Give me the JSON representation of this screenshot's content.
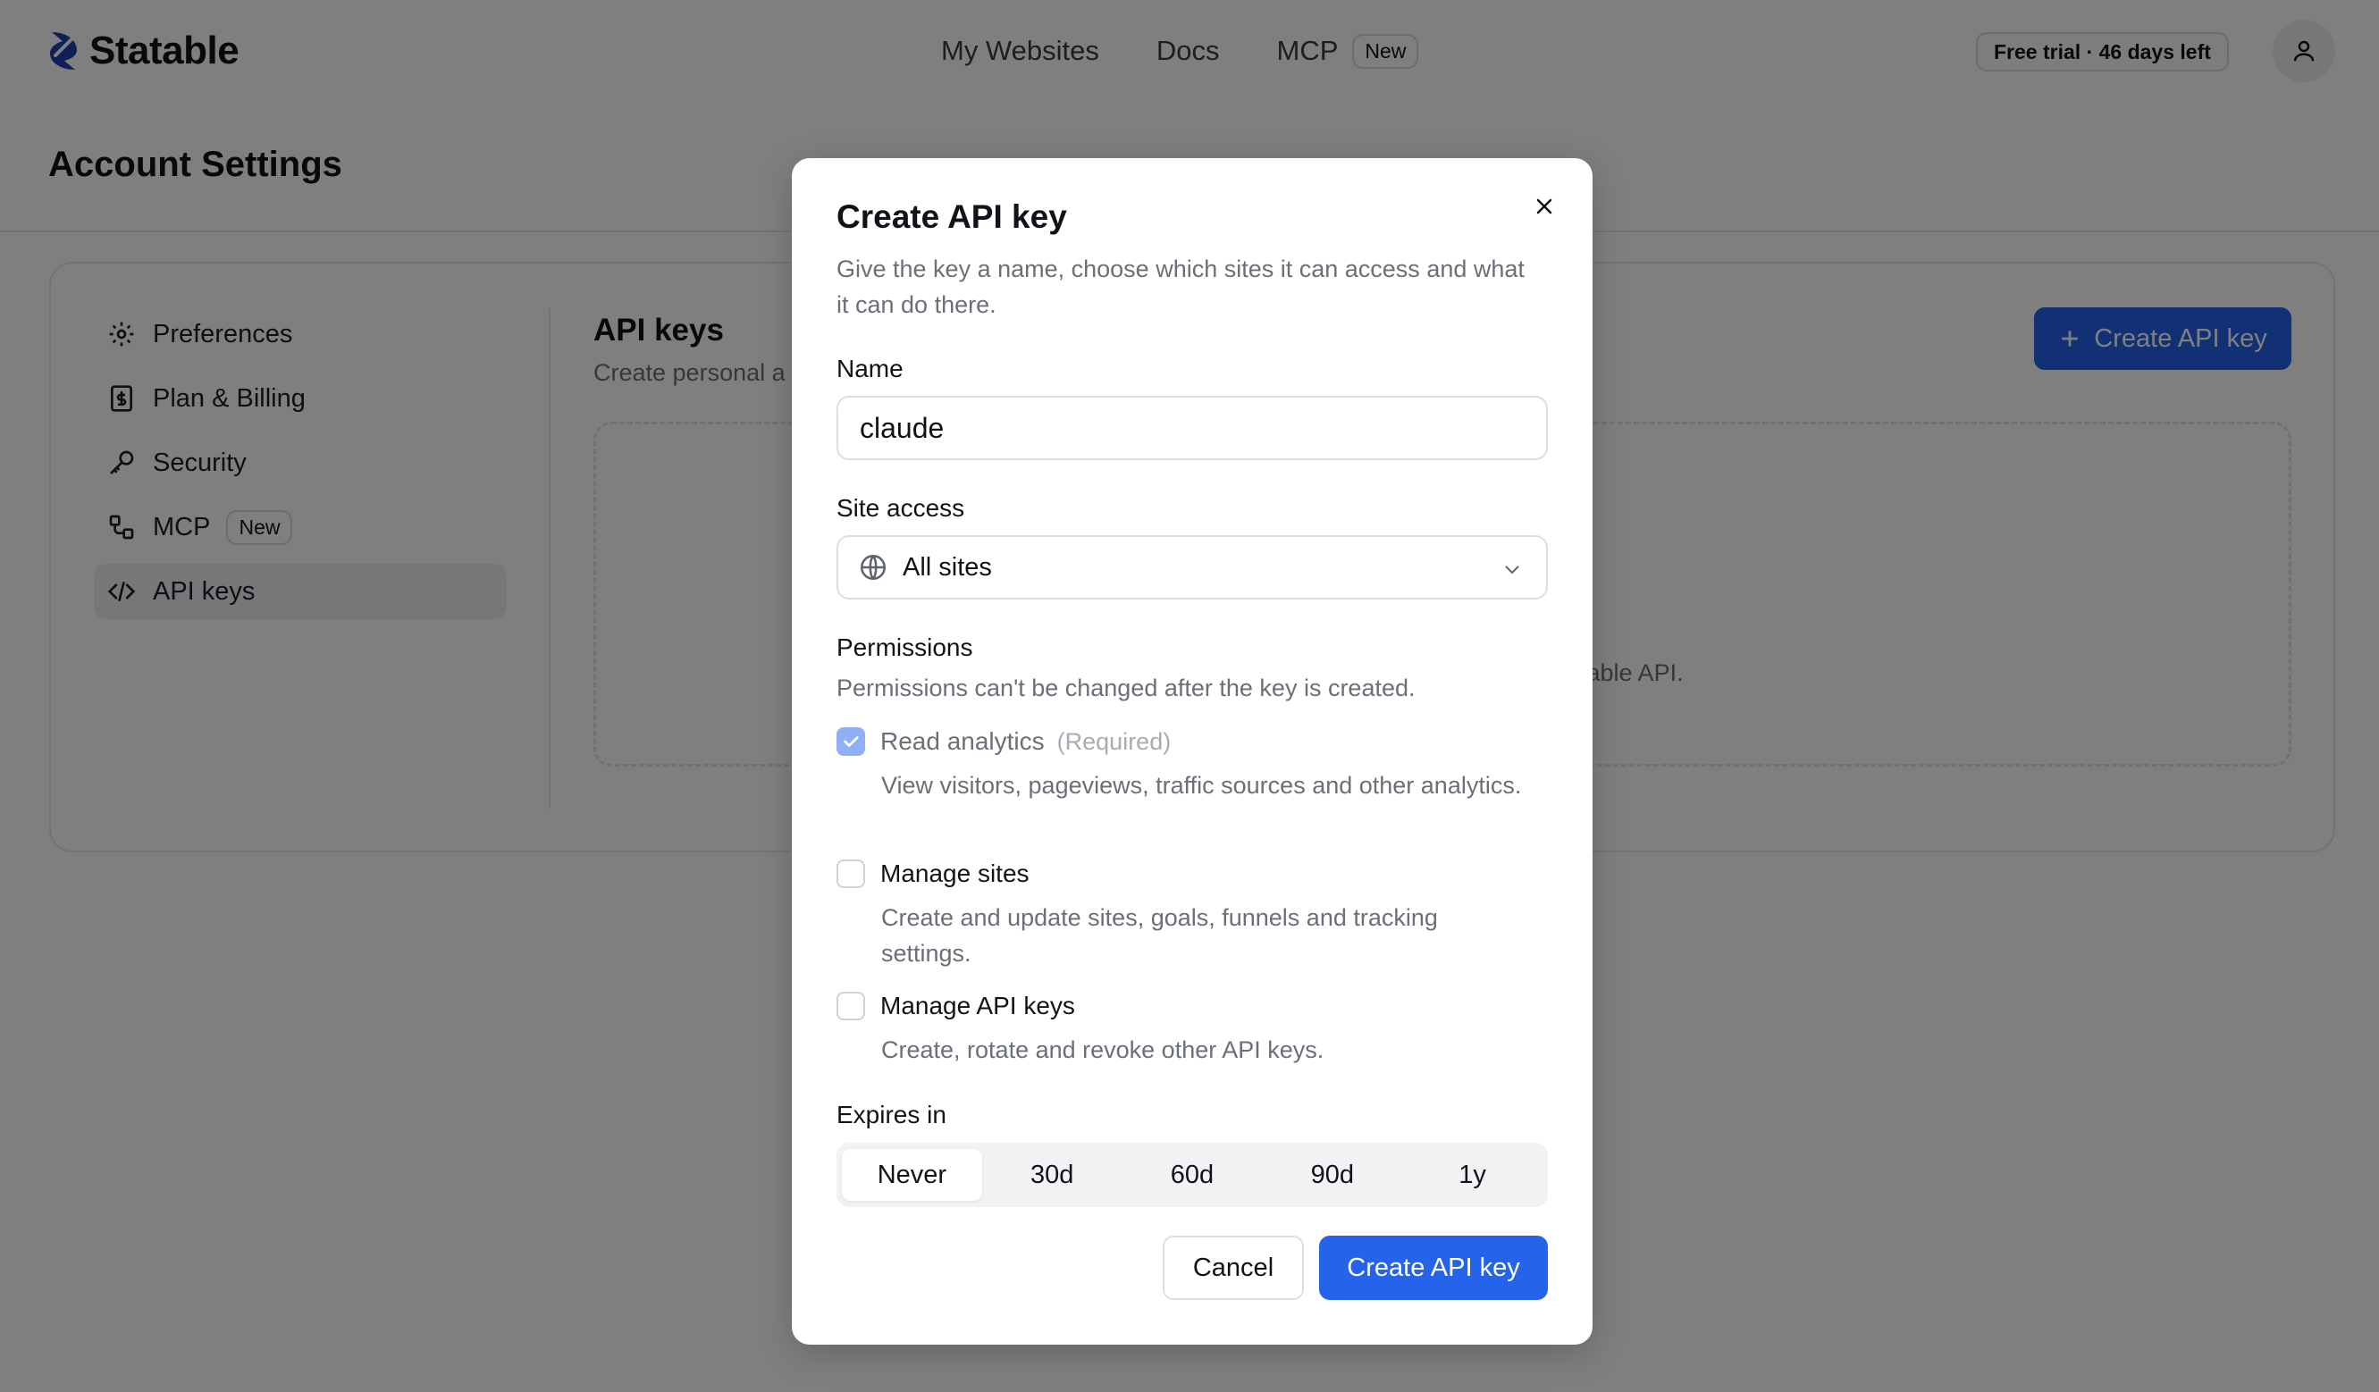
{
  "brand": {
    "name": "Statable",
    "color": "#1e40af"
  },
  "topnav": {
    "items": [
      {
        "label": "My Websites"
      },
      {
        "label": "Docs"
      },
      {
        "label": "MCP",
        "badge": "New"
      }
    ]
  },
  "header": {
    "trial": "Free trial · 46 days left"
  },
  "page": {
    "title": "Account Settings"
  },
  "sidebar": {
    "items": [
      {
        "label": "Preferences",
        "icon": "gear-icon"
      },
      {
        "label": "Plan & Billing",
        "icon": "billing-icon"
      },
      {
        "label": "Security",
        "icon": "key-icon"
      },
      {
        "label": "MCP",
        "icon": "mcp-icon",
        "badge": "New"
      },
      {
        "label": "API keys",
        "icon": "code-icon",
        "active": true
      }
    ]
  },
  "api_section": {
    "title": "API keys",
    "subtitle": "Create personal a",
    "create_button": "Create API key",
    "empty_text": "table API."
  },
  "modal": {
    "title": "Create API key",
    "description": "Give the key a name, choose which sites it can access and what it can do there.",
    "name_label": "Name",
    "name_value": "claude",
    "site_access_label": "Site access",
    "site_access_value": "All sites",
    "permissions_label": "Permissions",
    "permissions_note": "Permissions can't be changed after the key is created.",
    "permissions": [
      {
        "name": "Read analytics",
        "required": "(Required)",
        "checked": true,
        "description": "View visitors, pageviews, traffic sources and other analytics."
      },
      {
        "name": "Manage sites",
        "checked": false,
        "description": "Create and update sites, goals, funnels and tracking settings."
      },
      {
        "name": "Manage API keys",
        "checked": false,
        "description": "Create, rotate and revoke other API keys."
      }
    ],
    "expires_label": "Expires in",
    "expires_options": [
      "Never",
      "30d",
      "60d",
      "90d",
      "1y"
    ],
    "expires_selected": "Never",
    "cancel_label": "Cancel",
    "create_label": "Create API key"
  },
  "colors": {
    "accent": "#2563eb",
    "overlay": "rgba(0,0,0,0.5)"
  }
}
